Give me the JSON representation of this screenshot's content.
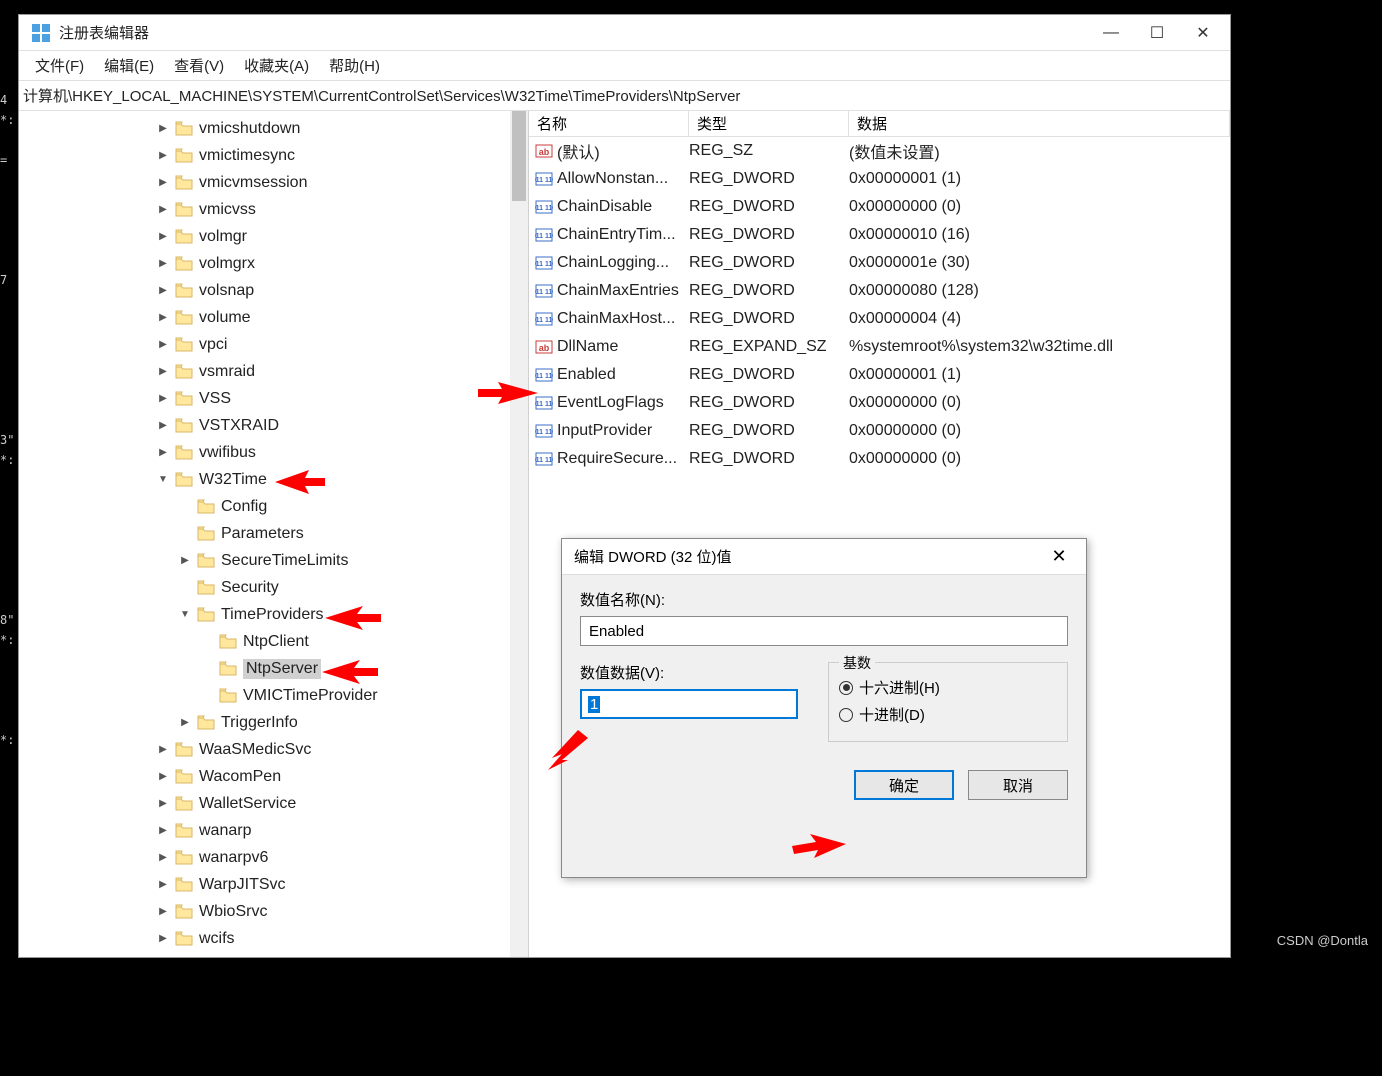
{
  "window": {
    "title": "注册表编辑器",
    "minimize": "—",
    "maximize": "☐",
    "close": "✕"
  },
  "menubar": {
    "file": "文件(F)",
    "edit": "编辑(E)",
    "view": "查看(V)",
    "favorites": "收藏夹(A)",
    "help": "帮助(H)"
  },
  "address": "计算机\\HKEY_LOCAL_MACHINE\\SYSTEM\\CurrentControlSet\\Services\\W32Time\\TimeProviders\\NtpServer",
  "tree": [
    {
      "indent": 3,
      "expander": ">",
      "label": "vmicshutdown"
    },
    {
      "indent": 3,
      "expander": ">",
      "label": "vmictimesync"
    },
    {
      "indent": 3,
      "expander": ">",
      "label": "vmicvmsession"
    },
    {
      "indent": 3,
      "expander": ">",
      "label": "vmicvss"
    },
    {
      "indent": 3,
      "expander": ">",
      "label": "volmgr"
    },
    {
      "indent": 3,
      "expander": ">",
      "label": "volmgrx"
    },
    {
      "indent": 3,
      "expander": ">",
      "label": "volsnap"
    },
    {
      "indent": 3,
      "expander": ">",
      "label": "volume"
    },
    {
      "indent": 3,
      "expander": ">",
      "label": "vpci"
    },
    {
      "indent": 3,
      "expander": ">",
      "label": "vsmraid"
    },
    {
      "indent": 3,
      "expander": ">",
      "label": "VSS"
    },
    {
      "indent": 3,
      "expander": ">",
      "label": "VSTXRAID"
    },
    {
      "indent": 3,
      "expander": ">",
      "label": "vwifibus"
    },
    {
      "indent": 3,
      "expander": "v",
      "label": "W32Time"
    },
    {
      "indent": 4,
      "expander": "",
      "label": "Config"
    },
    {
      "indent": 4,
      "expander": "",
      "label": "Parameters"
    },
    {
      "indent": 4,
      "expander": ">",
      "label": "SecureTimeLimits"
    },
    {
      "indent": 4,
      "expander": "",
      "label": "Security"
    },
    {
      "indent": 4,
      "expander": "v",
      "label": "TimeProviders"
    },
    {
      "indent": 5,
      "expander": "",
      "label": "NtpClient"
    },
    {
      "indent": 5,
      "expander": "",
      "label": "NtpServer",
      "selected": true
    },
    {
      "indent": 5,
      "expander": "",
      "label": "VMICTimeProvider"
    },
    {
      "indent": 4,
      "expander": ">",
      "label": "TriggerInfo"
    },
    {
      "indent": 3,
      "expander": ">",
      "label": "WaaSMedicSvc"
    },
    {
      "indent": 3,
      "expander": ">",
      "label": "WacomPen"
    },
    {
      "indent": 3,
      "expander": ">",
      "label": "WalletService"
    },
    {
      "indent": 3,
      "expander": ">",
      "label": "wanarp"
    },
    {
      "indent": 3,
      "expander": ">",
      "label": "wanarpv6"
    },
    {
      "indent": 3,
      "expander": ">",
      "label": "WarpJITSvc"
    },
    {
      "indent": 3,
      "expander": ">",
      "label": "WbioSrvc"
    },
    {
      "indent": 3,
      "expander": ">",
      "label": "wcifs"
    }
  ],
  "list": {
    "headers": {
      "name": "名称",
      "type": "类型",
      "data": "数据"
    },
    "rows": [
      {
        "icon": "sz",
        "name": "(默认)",
        "type": "REG_SZ",
        "data": "(数值未设置)"
      },
      {
        "icon": "bin",
        "name": "AllowNonstan...",
        "type": "REG_DWORD",
        "data": "0x00000001 (1)"
      },
      {
        "icon": "bin",
        "name": "ChainDisable",
        "type": "REG_DWORD",
        "data": "0x00000000 (0)"
      },
      {
        "icon": "bin",
        "name": "ChainEntryTim...",
        "type": "REG_DWORD",
        "data": "0x00000010 (16)"
      },
      {
        "icon": "bin",
        "name": "ChainLogging...",
        "type": "REG_DWORD",
        "data": "0x0000001e (30)"
      },
      {
        "icon": "bin",
        "name": "ChainMaxEntries",
        "type": "REG_DWORD",
        "data": "0x00000080 (128)"
      },
      {
        "icon": "bin",
        "name": "ChainMaxHost...",
        "type": "REG_DWORD",
        "data": "0x00000004 (4)"
      },
      {
        "icon": "sz",
        "name": "DllName",
        "type": "REG_EXPAND_SZ",
        "data": "%systemroot%\\system32\\w32time.dll"
      },
      {
        "icon": "bin",
        "name": "Enabled",
        "type": "REG_DWORD",
        "data": "0x00000001 (1)"
      },
      {
        "icon": "bin",
        "name": "EventLogFlags",
        "type": "REG_DWORD",
        "data": "0x00000000 (0)"
      },
      {
        "icon": "bin",
        "name": "InputProvider",
        "type": "REG_DWORD",
        "data": "0x00000000 (0)"
      },
      {
        "icon": "bin",
        "name": "RequireSecure...",
        "type": "REG_DWORD",
        "data": "0x00000000 (0)"
      }
    ]
  },
  "dialog": {
    "title": "编辑 DWORD (32 位)值",
    "name_label": "数值名称(N):",
    "name_value": "Enabled",
    "data_label": "数值数据(V):",
    "data_value": "1",
    "base_label": "基数",
    "hex_label": "十六进制(H)",
    "dec_label": "十进制(D)",
    "ok": "确定",
    "cancel": "取消",
    "close": "✕"
  },
  "watermark": "CSDN @Dontla"
}
